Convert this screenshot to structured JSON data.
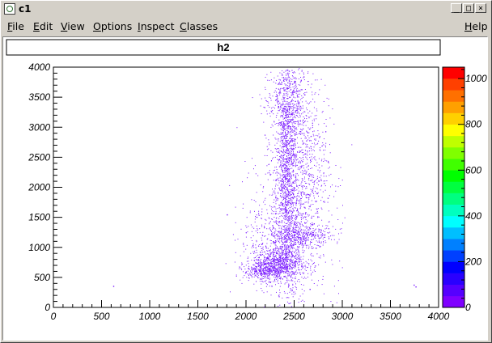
{
  "window": {
    "title": "c1",
    "minimize_glyph": "_",
    "maximize_glyph": "□",
    "close_glyph": "×"
  },
  "menu": {
    "items": [
      {
        "label": "File",
        "accel": "F"
      },
      {
        "label": "Edit",
        "accel": "E"
      },
      {
        "label": "View",
        "accel": "V"
      },
      {
        "label": "Options",
        "accel": "O"
      },
      {
        "label": "Inspect",
        "accel": "I"
      },
      {
        "label": "Classes",
        "accel": "C"
      }
    ],
    "help": {
      "label": "Help",
      "accel": "H"
    }
  },
  "chart_data": {
    "type": "heatmap",
    "title": "h2",
    "xlim": [
      0,
      4000
    ],
    "ylim": [
      0,
      4000
    ],
    "x_ticks": [
      0,
      500,
      1000,
      1500,
      2000,
      2500,
      3000,
      3500,
      4000
    ],
    "y_ticks": [
      0,
      500,
      1000,
      1500,
      2000,
      2500,
      3000,
      3500,
      4000
    ],
    "z_ticks": [
      0,
      200,
      400,
      600,
      800,
      1000
    ],
    "zlim": [
      0,
      1050
    ],
    "palette": [
      "#7f00ff",
      "#5500ff",
      "#2a00ff",
      "#0000ff",
      "#0040ff",
      "#0080ff",
      "#00bfff",
      "#00ffff",
      "#00ffbf",
      "#00ff80",
      "#00ff40",
      "#00ff00",
      "#40ff00",
      "#80ff00",
      "#bfff00",
      "#ffff00",
      "#ffd000",
      "#ffa000",
      "#ff7000",
      "#ff4000",
      "#ff0000"
    ],
    "point_color": "#7a1aff",
    "density_regions": [
      {
        "cx": 2420,
        "cy": 2200,
        "sx": 55,
        "sy": 1050,
        "n": 1300
      },
      {
        "cx": 2560,
        "cy": 2400,
        "sx": 140,
        "sy": 900,
        "n": 900
      },
      {
        "cx": 2420,
        "cy": 3400,
        "sx": 120,
        "sy": 350,
        "n": 300
      },
      {
        "cx": 2350,
        "cy": 750,
        "sx": 140,
        "sy": 130,
        "n": 600
      },
      {
        "cx": 2200,
        "cy": 620,
        "sx": 110,
        "sy": 80,
        "n": 350
      },
      {
        "cx": 2600,
        "cy": 1200,
        "sx": 150,
        "sy": 90,
        "n": 300
      },
      {
        "cx": 2300,
        "cy": 1100,
        "sx": 180,
        "sy": 400,
        "n": 350
      },
      {
        "cx": 2450,
        "cy": 1500,
        "sx": 260,
        "sy": 700,
        "n": 400
      }
    ],
    "outliers": [
      {
        "x": 620,
        "y": 360
      },
      {
        "x": 3740,
        "y": 380
      },
      {
        "x": 3760,
        "y": 350
      },
      {
        "x": 1800,
        "y": 1550
      },
      {
        "x": 2660,
        "y": 310
      }
    ]
  }
}
